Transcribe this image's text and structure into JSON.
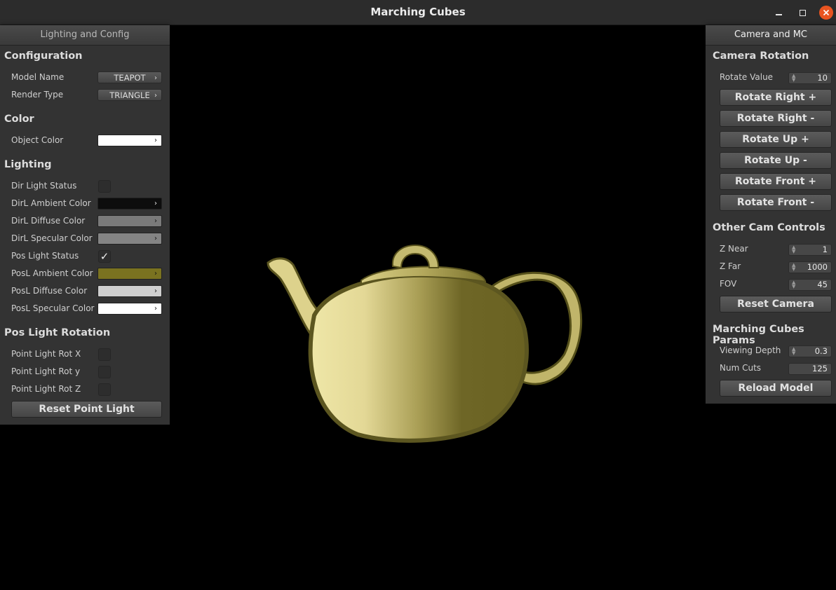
{
  "window": {
    "title": "Marching Cubes"
  },
  "left_panel": {
    "header": "Lighting and Config",
    "configuration": {
      "title": "Configuration",
      "model_label": "Model Name",
      "model_value": "TEAPOT",
      "render_label": "Render Type",
      "render_value": "TRIANGLE"
    },
    "color": {
      "title": "Color",
      "object_color_label": "Object Color",
      "object_color": "#ffffff"
    },
    "lighting": {
      "title": "Lighting",
      "dir_status_label": "Dir Light Status",
      "dir_status": false,
      "dir_ambient_label": "DirL Ambient Color",
      "dir_ambient": "#0d0d0d",
      "dir_diffuse_label": "DirL Diffuse Color",
      "dir_diffuse": "#7a7a7a",
      "dir_specular_label": "DirL Specular Color",
      "dir_specular": "#848484",
      "pos_status_label": "Pos Light Status",
      "pos_status": true,
      "pos_ambient_label": "PosL Ambient Color",
      "pos_ambient": "#7a7220",
      "pos_diffuse_label": "PosL Diffuse Color",
      "pos_diffuse": "#cfcfcf",
      "pos_specular_label": "PosL Specular Color",
      "pos_specular": "#ffffff"
    },
    "pos_light_rotation": {
      "title": "Pos Light Rotation",
      "rot_x_label": "Point Light Rot X",
      "rot_y_label": "Point Light Rot y",
      "rot_z_label": "Point Light Rot Z",
      "reset_label": "Reset Point Light"
    }
  },
  "right_panel": {
    "header": "Camera and MC",
    "camera_rotation": {
      "title": "Camera Rotation",
      "rotate_value_label": "Rotate Value",
      "rotate_value": "10",
      "buttons": [
        "Rotate Right +",
        "Rotate Right -",
        "Rotate Up +",
        "Rotate Up -",
        "Rotate Front +",
        "Rotate Front -"
      ]
    },
    "other_cam": {
      "title": "Other Cam Controls",
      "znear_label": "Z Near",
      "znear": "1",
      "zfar_label": "Z Far",
      "zfar": "1000",
      "fov_label": "FOV",
      "fov": "45",
      "reset_label": "Reset Camera"
    },
    "mc_params": {
      "title": "Marching Cubes Params",
      "depth_label": "Viewing Depth",
      "depth": "0.3",
      "cuts_label": "Num Cuts",
      "cuts": "125",
      "reload_label": "Reload Model"
    }
  },
  "icons": {
    "close": "close-icon",
    "minimize": "minimize-icon",
    "maximize": "maximize-icon",
    "check": "checkmark-icon",
    "chevron": "chevron-right-icon",
    "spinner": "spinner-arrows-icon"
  }
}
